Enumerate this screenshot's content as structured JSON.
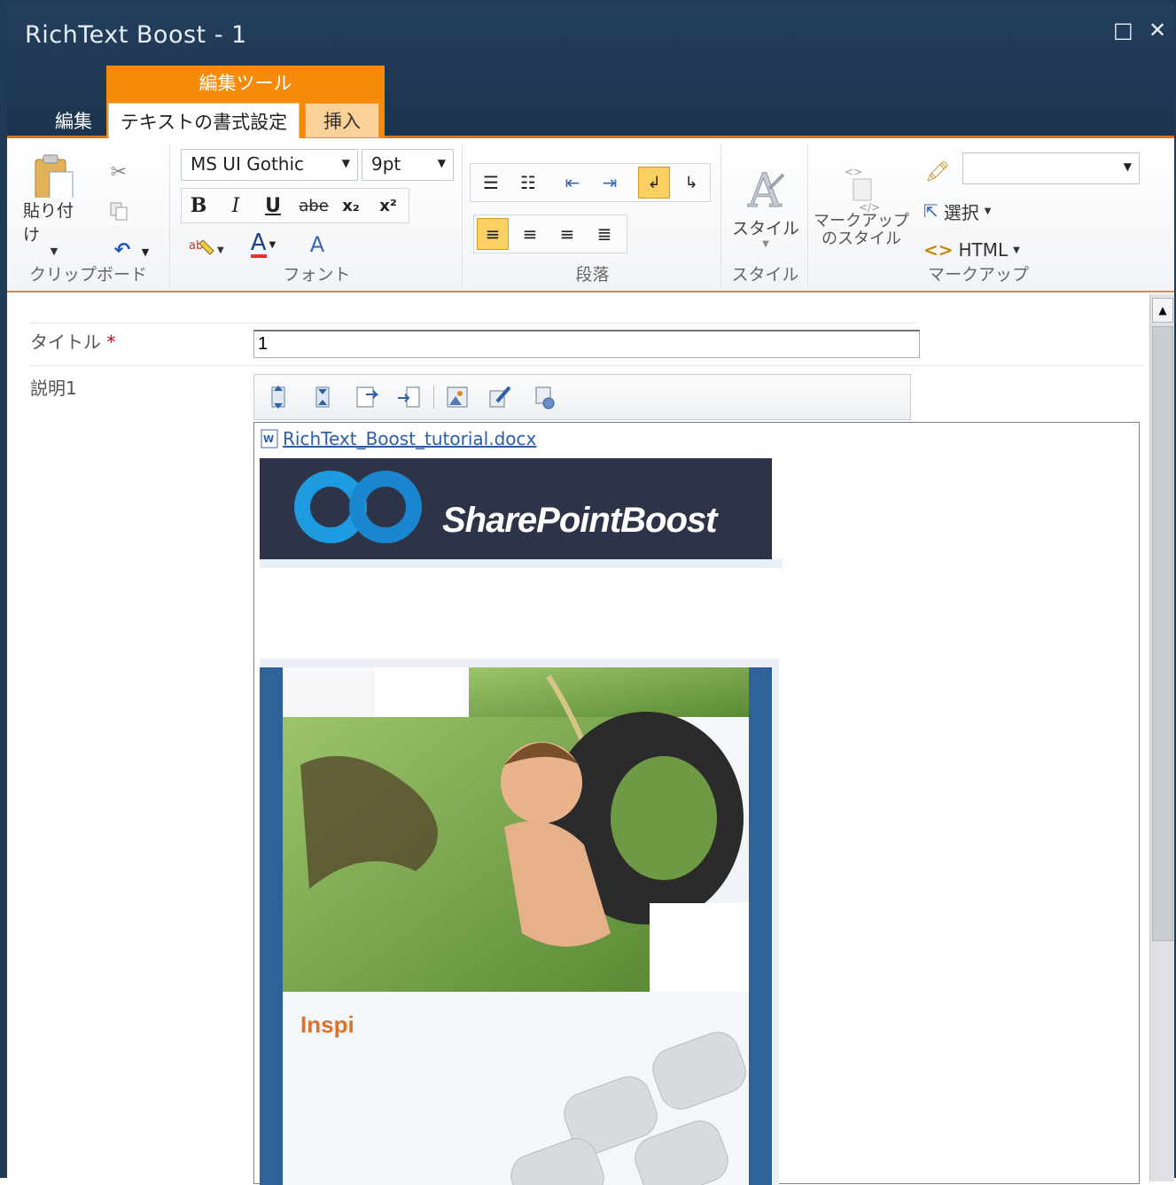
{
  "window": {
    "title": "RichText Boost - 1",
    "maximize_icon": "□",
    "close_icon": "✕"
  },
  "ribbon_tabs": {
    "context_group": "編集ツール",
    "edit": "編集",
    "format": "テキストの書式設定",
    "insert": "挿入"
  },
  "clipboard": {
    "paste": "貼り付け",
    "label": "クリップボード"
  },
  "font": {
    "family": "MS UI Gothic",
    "size": "9pt",
    "label": "フォント",
    "bold": "B",
    "italic": "I",
    "underline": "U",
    "strike": "abe",
    "subscript": "x₂",
    "superscript": "x²",
    "color": "A"
  },
  "paragraph": {
    "label": "段落"
  },
  "styles": {
    "button": "スタイル",
    "label": "スタイル"
  },
  "markup": {
    "styles_button_line1": "マークアップ",
    "styles_button_line2": "のスタイル",
    "select": "選択",
    "html": "HTML",
    "label": "マークアップ"
  },
  "form": {
    "title_label": "タイトル",
    "required_mark": "*",
    "title_value": "1",
    "desc_label": "説明1",
    "attachment_link": "RichText_Boost_tutorial.docx",
    "banner_text": "SharePointBoost",
    "photo_caption": "Inspi"
  },
  "colors": {
    "titlebar": "#1f3a57",
    "accent_orange": "#f58a0b",
    "link": "#2a5db0",
    "banner": "#2e3448",
    "frame_blue": "#2f6299"
  }
}
